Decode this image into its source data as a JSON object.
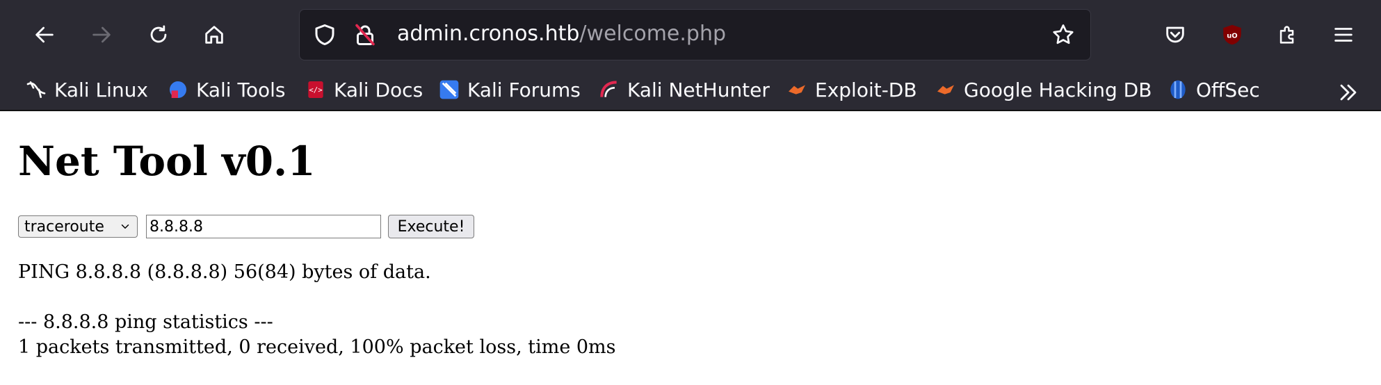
{
  "browser": {
    "url_host": "admin.cronos.htb",
    "url_path": "/welcome.php",
    "bookmarks": [
      {
        "label": "Kali Linux",
        "icon": "kali-dragon-icon"
      },
      {
        "label": "Kali Tools",
        "icon": "kali-tools-icon"
      },
      {
        "label": "Kali Docs",
        "icon": "kali-docs-icon"
      },
      {
        "label": "Kali Forums",
        "icon": "kali-forums-icon"
      },
      {
        "label": "Kali NetHunter",
        "icon": "kali-nethunter-icon"
      },
      {
        "label": "Exploit-DB",
        "icon": "exploit-db-icon"
      },
      {
        "label": "Google Hacking DB",
        "icon": "ghdb-icon"
      },
      {
        "label": "OffSec",
        "icon": "offsec-icon"
      }
    ]
  },
  "page": {
    "title": "Net Tool v0.1",
    "command_select": "traceroute",
    "host_input": "8.8.8.8",
    "execute_label": "Execute!",
    "output": [
      "PING 8.8.8.8 (8.8.8.8) 56(84) bytes of data.",
      "",
      "--- 8.8.8.8 ping statistics ---",
      "1 packets transmitted, 0 received, 100% packet loss, time 0ms"
    ]
  }
}
